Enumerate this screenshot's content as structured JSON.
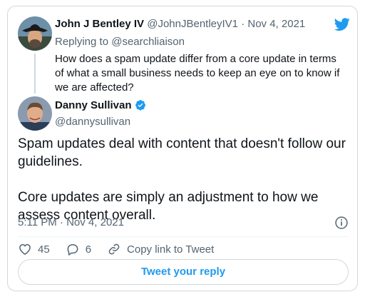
{
  "parent": {
    "name": "John J Bentley IV",
    "handle": "@JohnJBentleyIV1",
    "date": "Nov 4, 2021",
    "replying_prefix": "Replying to ",
    "replying_to": "@searchliaison",
    "text": "How does a spam update differ from a core update in terms of what a small business needs to keep an eye on to know if we are affected?"
  },
  "tweet": {
    "name": "Danny Sullivan",
    "handle": "@dannysullivan",
    "paragraph1": "Spam updates deal with content that doesn't follow our guidelines.",
    "paragraph2": "Core updates are simply an adjustment to how we assess content overall.",
    "timestamp": "5:11 PM · Nov 4, 2021"
  },
  "actions": {
    "likes": "45",
    "replies": "6",
    "copy_link": "Copy link to Tweet"
  },
  "reply_button": "Tweet your reply",
  "icons": {
    "brand": "twitter-bird-icon",
    "verified": "verified-badge-icon",
    "info": "info-icon",
    "like": "heart-icon",
    "reply": "reply-bubble-icon",
    "link": "link-icon"
  },
  "colors": {
    "accent": "#1d9bf0",
    "text": "#0f1419",
    "muted": "#536471",
    "border": "#cfd9de"
  }
}
